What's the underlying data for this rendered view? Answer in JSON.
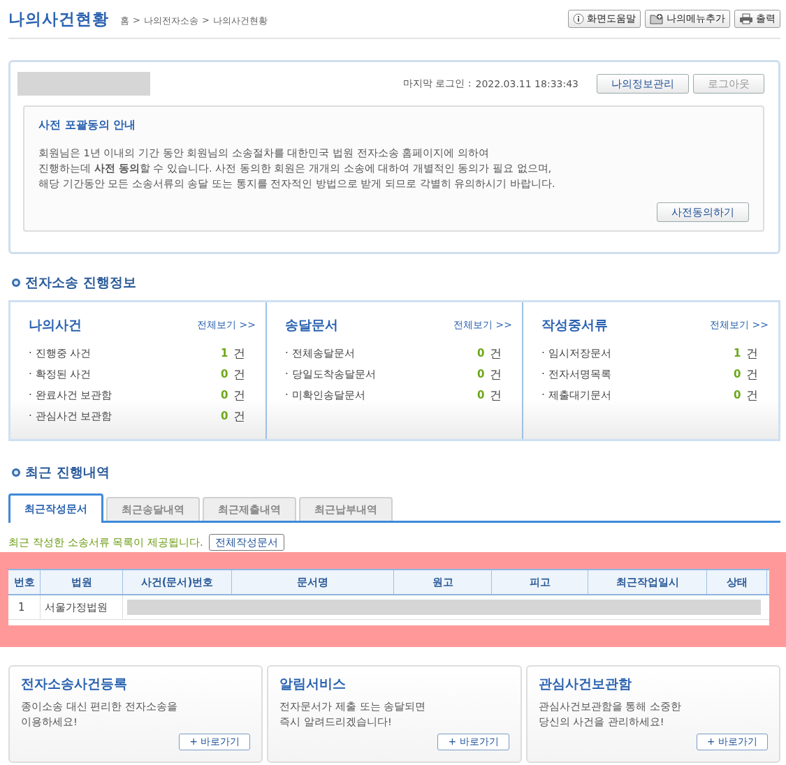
{
  "header": {
    "title": "나의사건현황",
    "breadcrumb": [
      "홈",
      "나의전자소송",
      "나의사건현황"
    ],
    "separator": ">",
    "tools": [
      {
        "kind": "info",
        "label": "화면도움말"
      },
      {
        "kind": "folder",
        "label": "나의메뉴추가"
      },
      {
        "kind": "print",
        "label": "출력"
      }
    ]
  },
  "login": {
    "label": "마지막 로그인 :",
    "time": "2022.03.11 18:33:43",
    "buttons": [
      {
        "label": "나의정보관리",
        "kind": "primary"
      },
      {
        "label": "로그아웃",
        "kind": "muted"
      }
    ]
  },
  "notice": {
    "title": "사전 포괄동의 안내",
    "lines": [
      "회원님은 1년 이내의 기간 동안 회원님의 소송절차를 대한민국 법원 전자소송 홈페이지에 의하여",
      "진행하는데 **사전 동의**할 수 있습니다. 사전 동의한 회원은 개개의 소송에 대하여 개별적인 동의가 필요 없으며,",
      "해당 기간동안 모든 소송서류의 송달 또는 통지를 전자적인 방법으로 받게 되므로 각별히 유의하시기 바랍니다."
    ],
    "button": "사전동의하기"
  },
  "progress": {
    "title": "전자소송 진행정보",
    "panels": [
      {
        "title": "나의사건",
        "more": "전체보기 >>",
        "items": [
          {
            "label": "· 진행중 사건",
            "count": "1",
            "unit": "건"
          },
          {
            "label": "· 확정된 사건",
            "count": "0",
            "unit": "건"
          },
          {
            "label": "· 완료사건 보관함",
            "count": "0",
            "unit": "건"
          },
          {
            "label": "· 관심사건 보관함",
            "count": "0",
            "unit": "건"
          }
        ]
      },
      {
        "title": "송달문서",
        "more": "전체보기 >>",
        "items": [
          {
            "label": "· 전체송달문서",
            "count": "0",
            "unit": "건"
          },
          {
            "label": "· 당일도착송달문서",
            "count": "0",
            "unit": "건"
          },
          {
            "label": "· 미확인송달문서",
            "count": "0",
            "unit": "건"
          }
        ]
      },
      {
        "title": "작성중서류",
        "more": "전체보기 >>",
        "items": [
          {
            "label": "· 임시저장문서",
            "count": "1",
            "unit": "건"
          },
          {
            "label": "· 전자서명목록",
            "count": "0",
            "unit": "건"
          },
          {
            "label": "· 제출대기문서",
            "count": "0",
            "unit": "건"
          }
        ]
      }
    ]
  },
  "recent": {
    "title": "최근 진행내역",
    "tabs": [
      {
        "label": "최근작성문서",
        "selected": true
      },
      {
        "label": "최근송달내역",
        "selected": false
      },
      {
        "label": "최근제출내역",
        "selected": false
      },
      {
        "label": "최근납부내역",
        "selected": false
      }
    ],
    "description": "최근 작성한 소송서류 목록이 제공됩니다.",
    "button": "전체작성문서",
    "table": {
      "columns": [
        "번호",
        "법원",
        "사건(문서)번호",
        "문서명",
        "원고",
        "피고",
        "최근작업일시",
        "상태"
      ],
      "rows": [
        {
          "cells": [
            "1",
            "서울가정법원"
          ]
        }
      ]
    }
  },
  "cards": [
    {
      "title": "전자소송사건등록",
      "lines": [
        "종이소송 대신 편리한 전자소송을",
        "이용하세요!"
      ],
      "button": "+ 바로가기"
    },
    {
      "title": "알림서비스",
      "lines": [
        "전자문서가 제출 또는 송달되면",
        "즉시 알려드리겠습니다!"
      ],
      "button": "+ 바로가기"
    },
    {
      "title": "관심사건보관함",
      "lines": [
        "관심사건보관함을 통해 소중한",
        "당신의 사건을 관리하세요!"
      ],
      "button": "+ 바로가기"
    }
  ]
}
